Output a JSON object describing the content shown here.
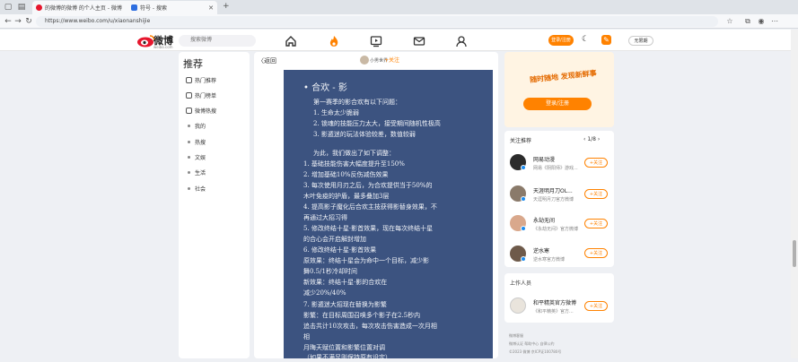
{
  "browser": {
    "tabs": [
      {
        "title": "的微博的微博 的个人主页 - 微博",
        "active": true
      },
      {
        "title": "符号 - 搜索",
        "active": false
      }
    ],
    "url": "https://www.weibo.com/u/xiaonanshijie"
  },
  "header": {
    "logo": "微博",
    "logo_sub": "weibo.com",
    "search_placeholder": "搜索微博",
    "cta": "登录/注册",
    "profile": "无限期"
  },
  "sidebar": {
    "title": "推荐",
    "items": [
      {
        "label": "热门推荐",
        "icon": "fire-icon"
      },
      {
        "label": "热门榜单",
        "icon": "list-icon"
      },
      {
        "label": "微博热搜",
        "icon": "trend-icon"
      },
      {
        "label": "我的",
        "icon": "dot"
      },
      {
        "label": "热搜",
        "icon": "dot"
      },
      {
        "label": "文娱",
        "icon": "dot"
      },
      {
        "label": "生活",
        "icon": "dot"
      },
      {
        "label": "社会",
        "icon": "dot"
      }
    ]
  },
  "post": {
    "back": "返回",
    "author": "小男世界",
    "follow": "+关注",
    "lines": [
      "• 合欢 - 影",
      "第一赛季的影合欢有以下问题：",
      "1. 生命太少脆弱",
      "2. 锁魂的技能压力太大，接受期间随机性极高",
      "3. 影遁迷的玩法体验较差，数值较弱",
      "",
      "为此，我们做出了如下调整：",
      "1. 基础技能伤害大幅度提升至150%",
      "2. 增加基础10%反伤减伤效果",
      "3. 每次使用月刃之后，为合欢提供当于50%的",
      "   木叶免疫的护盾，最多叠加3层",
      "4. 提高影子魔化后合欢主技获得影替身效果，不",
      "   再通过大招习得",
      "5. 修改终结十星·影首效果，现在每次终结十星",
      "   的合心会开启解封增加",
      "6. 修改终结十星·影首效果",
      "   原效果：终结十星会为命中一个目标，减少影",
      "   舞0.5/1秒冷却时间",
      "   新效果：终结十星·影的合欢在",
      "   减少20%/40%",
      "7. 影遁迷大招现在替换为影繁",
      "   影繁：在目标周围召唤多个影子在2.5秒内",
      "   追击共计10次攻击，每次攻击伤害造成一次月相",
      "   相",
      "   月晦天赋位置和影繁位置对调",
      "   （如果不满足则保持原有设定）"
    ]
  },
  "right": {
    "banner_art": "随时随地 发现新鲜事",
    "banner_btn": "登录/注册",
    "rec_title": "关注推荐",
    "rec_page": "1/8",
    "recs": [
      {
        "name": "网易动漫",
        "desc": "网易《阴阳师》游戏...",
        "color": "#2b2b2b"
      },
      {
        "name": "天涯明月刀OL...",
        "desc": "天涯明月刀官方微博",
        "color": "#8a7a6a"
      },
      {
        "name": "永劫无间",
        "desc": "《永劫无间》官方微博",
        "color": "#d9a88c"
      },
      {
        "name": "逆水寒",
        "desc": "逆水寒官方微博",
        "color": "#6e5a4a"
      }
    ],
    "follow_label": "+关注",
    "biz_title": "上作人员",
    "biz": {
      "name": "和平精英官方微博",
      "desc": "《和平精英》官方..."
    },
    "footer": [
      "微博客服",
      "微博认证 帮助中心 自律公约",
      "©2023 微博 京ICP证100780号"
    ]
  }
}
